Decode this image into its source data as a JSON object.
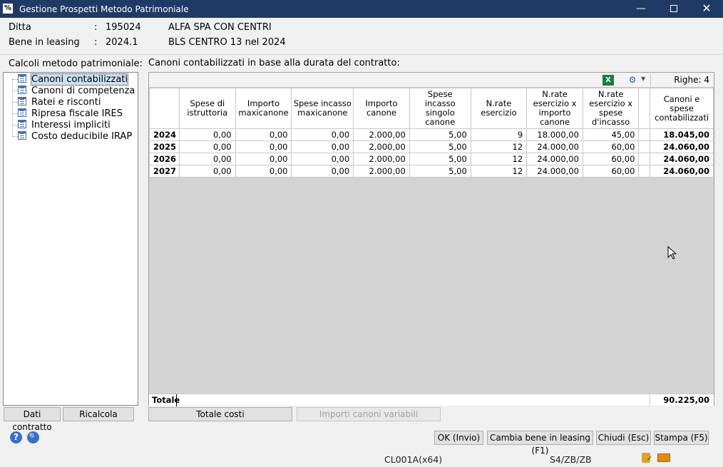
{
  "window": {
    "title": "Gestione Prospetti Metodo Patrimoniale",
    "app_icon": "%",
    "minimize": "—",
    "close": "✕"
  },
  "header": {
    "ditta_label": "Ditta",
    "ditta_sep": ":",
    "ditta_code": "195024",
    "ditta_name": "ALFA SPA CON CENTRI",
    "bene_label": "Bene in leasing",
    "bene_sep": ":",
    "bene_code": "2024.1",
    "bene_name": "BLS CENTRO 13 nel 2024"
  },
  "sidebar": {
    "title": "Calcoli metodo patrimoniale:",
    "items": [
      {
        "label": "Canoni contabilizzati",
        "selected": true
      },
      {
        "label": "Canoni di competenza"
      },
      {
        "label": "Ratei e risconti"
      },
      {
        "label": "Ripresa fiscale IRES"
      },
      {
        "label": "Interessi impliciti"
      },
      {
        "label": "Costo deducibile IRAP"
      }
    ],
    "btn_dati": "Dati contratto",
    "btn_ricalcola": "Ricalcola"
  },
  "main": {
    "title": "Canoni contabilizzati in base alla durata del contratto:",
    "toolbar": {
      "excel_icon": "X",
      "filter_icon": "⚙",
      "dropdown_icon": "▼",
      "rows_count": "Righe: 4"
    },
    "columns": [
      "",
      "Spese di istruttoria",
      "Importo maxicanone",
      "Spese incasso maxicanone",
      "Importo canone",
      "Spese incasso singolo canone",
      "N.rate esercizio",
      "N.rate esercizio x importo canone",
      "N.rate esercizio x spese d'incasso",
      "",
      "Canoni e spese contabilizzati"
    ],
    "rows": [
      [
        "2024",
        "0,00",
        "0,00",
        "0,00",
        "2.000,00",
        "5,00",
        "9",
        "18.000,00",
        "45,00",
        "",
        "18.045,00"
      ],
      [
        "2025",
        "0,00",
        "0,00",
        "0,00",
        "2.000,00",
        "5,00",
        "12",
        "24.000,00",
        "60,00",
        "",
        "24.060,00"
      ],
      [
        "2026",
        "0,00",
        "0,00",
        "0,00",
        "2.000,00",
        "5,00",
        "12",
        "24.000,00",
        "60,00",
        "",
        "24.060,00"
      ],
      [
        "2027",
        "0,00",
        "0,00",
        "0,00",
        "2.000,00",
        "5,00",
        "12",
        "24.000,00",
        "60,00",
        "",
        "24.060,00"
      ]
    ],
    "total_label": "Totale",
    "total_value": "90.225,00",
    "btn_totale_costi": "Totale costi",
    "btn_importi_variabili": "Importi canoni variabili"
  },
  "footer": {
    "help_icon": "?",
    "search_icon": "🔍",
    "btn_ok": "OK (Invio)",
    "btn_cambia": "Cambia bene in leasing (F1)",
    "btn_chiudi": "Chiudi (Esc)",
    "btn_stampa": "Stampa (F5)"
  },
  "status": {
    "module": "CL001A(x64)",
    "path": "S4/ZB/ZB"
  }
}
